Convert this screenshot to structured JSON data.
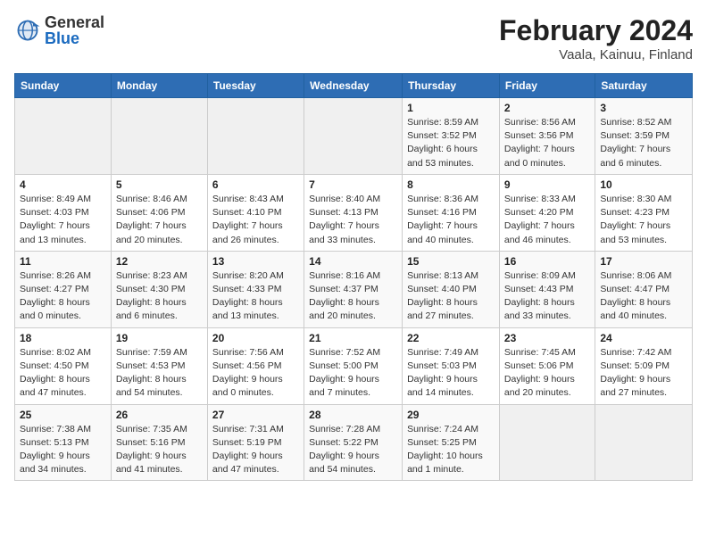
{
  "logo": {
    "general": "General",
    "blue": "Blue"
  },
  "title": "February 2024",
  "subtitle": "Vaala, Kainuu, Finland",
  "days_header": [
    "Sunday",
    "Monday",
    "Tuesday",
    "Wednesday",
    "Thursday",
    "Friday",
    "Saturday"
  ],
  "weeks": [
    [
      {
        "day": "",
        "info": ""
      },
      {
        "day": "",
        "info": ""
      },
      {
        "day": "",
        "info": ""
      },
      {
        "day": "",
        "info": ""
      },
      {
        "day": "1",
        "info": "Sunrise: 8:59 AM\nSunset: 3:52 PM\nDaylight: 6 hours\nand 53 minutes."
      },
      {
        "day": "2",
        "info": "Sunrise: 8:56 AM\nSunset: 3:56 PM\nDaylight: 7 hours\nand 0 minutes."
      },
      {
        "day": "3",
        "info": "Sunrise: 8:52 AM\nSunset: 3:59 PM\nDaylight: 7 hours\nand 6 minutes."
      }
    ],
    [
      {
        "day": "4",
        "info": "Sunrise: 8:49 AM\nSunset: 4:03 PM\nDaylight: 7 hours\nand 13 minutes."
      },
      {
        "day": "5",
        "info": "Sunrise: 8:46 AM\nSunset: 4:06 PM\nDaylight: 7 hours\nand 20 minutes."
      },
      {
        "day": "6",
        "info": "Sunrise: 8:43 AM\nSunset: 4:10 PM\nDaylight: 7 hours\nand 26 minutes."
      },
      {
        "day": "7",
        "info": "Sunrise: 8:40 AM\nSunset: 4:13 PM\nDaylight: 7 hours\nand 33 minutes."
      },
      {
        "day": "8",
        "info": "Sunrise: 8:36 AM\nSunset: 4:16 PM\nDaylight: 7 hours\nand 40 minutes."
      },
      {
        "day": "9",
        "info": "Sunrise: 8:33 AM\nSunset: 4:20 PM\nDaylight: 7 hours\nand 46 minutes."
      },
      {
        "day": "10",
        "info": "Sunrise: 8:30 AM\nSunset: 4:23 PM\nDaylight: 7 hours\nand 53 minutes."
      }
    ],
    [
      {
        "day": "11",
        "info": "Sunrise: 8:26 AM\nSunset: 4:27 PM\nDaylight: 8 hours\nand 0 minutes."
      },
      {
        "day": "12",
        "info": "Sunrise: 8:23 AM\nSunset: 4:30 PM\nDaylight: 8 hours\nand 6 minutes."
      },
      {
        "day": "13",
        "info": "Sunrise: 8:20 AM\nSunset: 4:33 PM\nDaylight: 8 hours\nand 13 minutes."
      },
      {
        "day": "14",
        "info": "Sunrise: 8:16 AM\nSunset: 4:37 PM\nDaylight: 8 hours\nand 20 minutes."
      },
      {
        "day": "15",
        "info": "Sunrise: 8:13 AM\nSunset: 4:40 PM\nDaylight: 8 hours\nand 27 minutes."
      },
      {
        "day": "16",
        "info": "Sunrise: 8:09 AM\nSunset: 4:43 PM\nDaylight: 8 hours\nand 33 minutes."
      },
      {
        "day": "17",
        "info": "Sunrise: 8:06 AM\nSunset: 4:47 PM\nDaylight: 8 hours\nand 40 minutes."
      }
    ],
    [
      {
        "day": "18",
        "info": "Sunrise: 8:02 AM\nSunset: 4:50 PM\nDaylight: 8 hours\nand 47 minutes."
      },
      {
        "day": "19",
        "info": "Sunrise: 7:59 AM\nSunset: 4:53 PM\nDaylight: 8 hours\nand 54 minutes."
      },
      {
        "day": "20",
        "info": "Sunrise: 7:56 AM\nSunset: 4:56 PM\nDaylight: 9 hours\nand 0 minutes."
      },
      {
        "day": "21",
        "info": "Sunrise: 7:52 AM\nSunset: 5:00 PM\nDaylight: 9 hours\nand 7 minutes."
      },
      {
        "day": "22",
        "info": "Sunrise: 7:49 AM\nSunset: 5:03 PM\nDaylight: 9 hours\nand 14 minutes."
      },
      {
        "day": "23",
        "info": "Sunrise: 7:45 AM\nSunset: 5:06 PM\nDaylight: 9 hours\nand 20 minutes."
      },
      {
        "day": "24",
        "info": "Sunrise: 7:42 AM\nSunset: 5:09 PM\nDaylight: 9 hours\nand 27 minutes."
      }
    ],
    [
      {
        "day": "25",
        "info": "Sunrise: 7:38 AM\nSunset: 5:13 PM\nDaylight: 9 hours\nand 34 minutes."
      },
      {
        "day": "26",
        "info": "Sunrise: 7:35 AM\nSunset: 5:16 PM\nDaylight: 9 hours\nand 41 minutes."
      },
      {
        "day": "27",
        "info": "Sunrise: 7:31 AM\nSunset: 5:19 PM\nDaylight: 9 hours\nand 47 minutes."
      },
      {
        "day": "28",
        "info": "Sunrise: 7:28 AM\nSunset: 5:22 PM\nDaylight: 9 hours\nand 54 minutes."
      },
      {
        "day": "29",
        "info": "Sunrise: 7:24 AM\nSunset: 5:25 PM\nDaylight: 10 hours\nand 1 minute."
      },
      {
        "day": "",
        "info": ""
      },
      {
        "day": "",
        "info": ""
      }
    ]
  ]
}
